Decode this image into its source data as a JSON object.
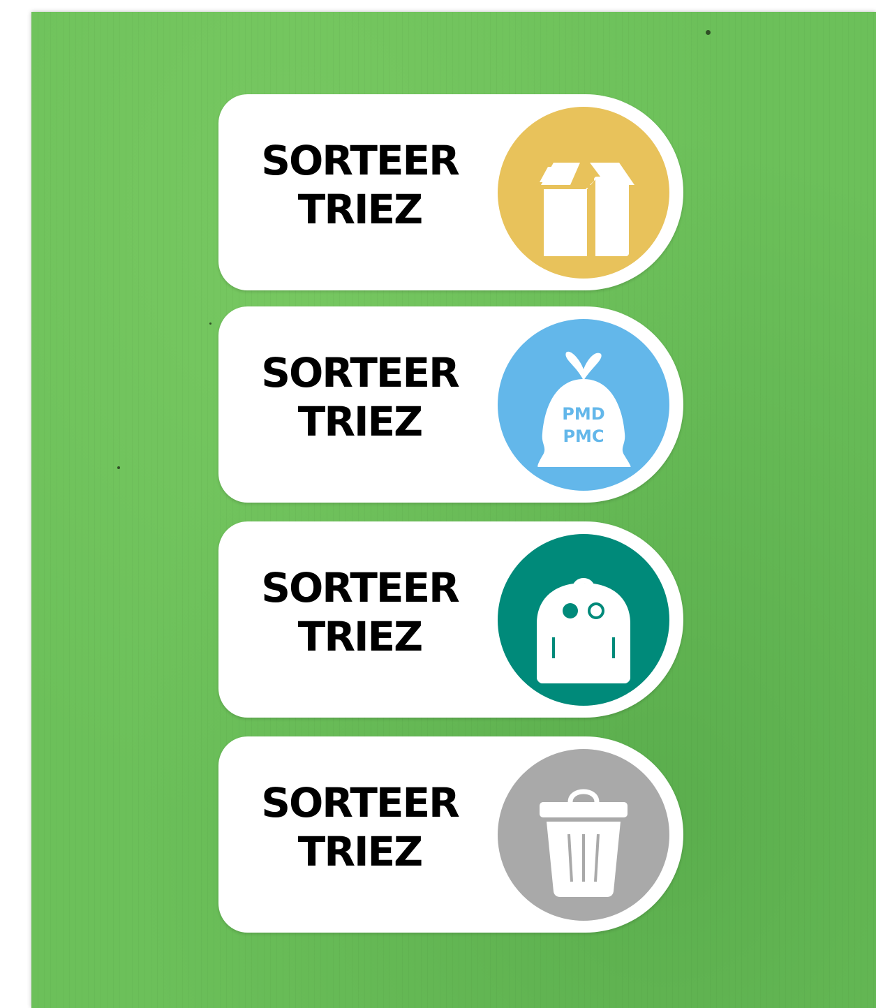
{
  "labels": [
    {
      "line1": "SORTEER",
      "line2": "TRIEZ",
      "icon": "cardboard-box-icon",
      "color": "#e8c25b"
    },
    {
      "line1": "SORTEER",
      "line2": "TRIEZ",
      "icon": "pmd-bag-icon",
      "color": "#63b7ea",
      "bag_text_1": "PMD",
      "bag_text_2": "PMC"
    },
    {
      "line1": "SORTEER",
      "line2": "TRIEZ",
      "icon": "organic-bin-icon",
      "color": "#008a7a"
    },
    {
      "line1": "SORTEER",
      "line2": "TRIEZ",
      "icon": "trash-can-icon",
      "color": "#a9a9a9"
    }
  ],
  "background_color": "#6cc05a"
}
